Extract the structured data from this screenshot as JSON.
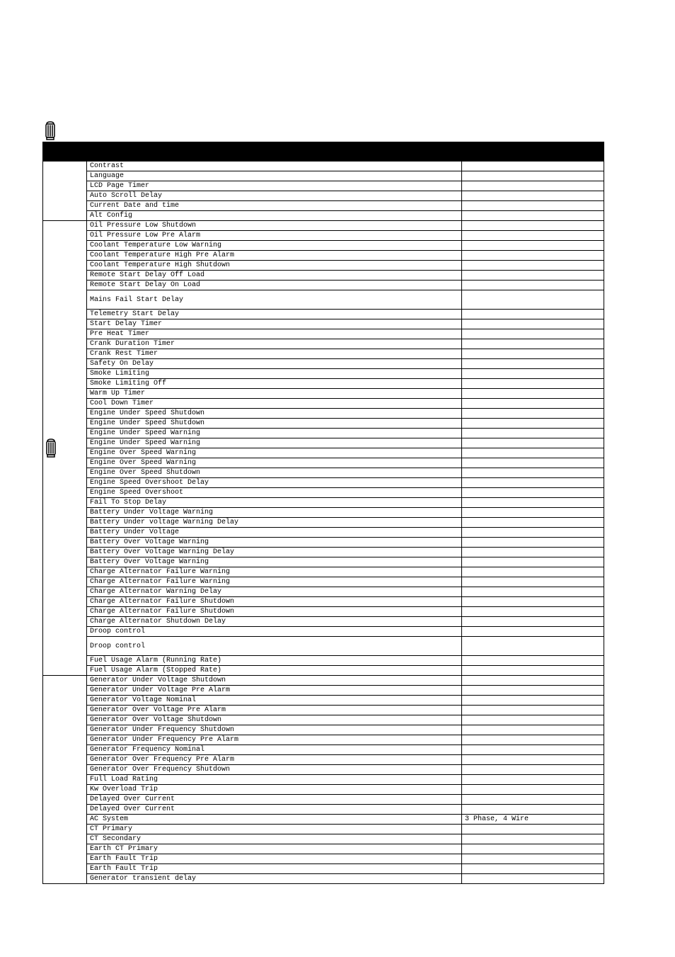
{
  "rows": [
    {
      "col1_type": "blank",
      "label": "Contrast",
      "value": "",
      "border_top_heavy": true
    },
    {
      "col1_type": "none",
      "label": "Language",
      "value": ""
    },
    {
      "col1_type": "none",
      "label": "LCD Page Timer",
      "value": ""
    },
    {
      "col1_type": "none",
      "label": "Auto Scroll Delay",
      "value": ""
    },
    {
      "col1_type": "none",
      "label": "Current Date and time",
      "value": ""
    },
    {
      "col1_type": "none",
      "label": "Alt Config",
      "value": ""
    },
    {
      "col1_type": "blank",
      "label": "Oil Pressure Low Shutdown",
      "value": "",
      "icon_rowspan": 43,
      "icon_name": "lantern-icon"
    },
    {
      "col1_type": "none",
      "label": "Oil Pressure Low Pre Alarm",
      "value": ""
    },
    {
      "col1_type": "none",
      "label": "Coolant Temperature Low Warning",
      "value": ""
    },
    {
      "col1_type": "none",
      "label": "Coolant Temperature High Pre Alarm",
      "value": ""
    },
    {
      "col1_type": "none",
      "label": "Coolant Temperature High Shutdown",
      "value": ""
    },
    {
      "col1_type": "none",
      "label": "Remote Start Delay Off Load",
      "value": ""
    },
    {
      "col1_type": "none",
      "label": "Remote Start Delay On Load",
      "value": ""
    },
    {
      "col1_type": "none",
      "label": "Mains Fail Start Delay",
      "value": "",
      "tall": true
    },
    {
      "col1_type": "none",
      "label": "Telemetry Start Delay",
      "value": ""
    },
    {
      "col1_type": "none",
      "label": "Start Delay Timer",
      "value": ""
    },
    {
      "col1_type": "none",
      "label": "Pre Heat Timer",
      "value": ""
    },
    {
      "col1_type": "none",
      "label": "Crank Duration Timer",
      "value": ""
    },
    {
      "col1_type": "none",
      "label": "Crank Rest Timer",
      "value": ""
    },
    {
      "col1_type": "none",
      "label": "Safety On Delay",
      "value": ""
    },
    {
      "col1_type": "none",
      "label": "Smoke Limiting",
      "value": ""
    },
    {
      "col1_type": "none",
      "label": "Smoke Limiting Off",
      "value": ""
    },
    {
      "col1_type": "none",
      "label": "Warm Up Timer",
      "value": ""
    },
    {
      "col1_type": "none",
      "label": "Cool Down Timer",
      "value": ""
    },
    {
      "col1_type": "none",
      "label": "Engine Under Speed Shutdown",
      "value": ""
    },
    {
      "col1_type": "none",
      "label": "Engine Under Speed Shutdown",
      "value": ""
    },
    {
      "col1_type": "none",
      "label": "Engine Under Speed Warning",
      "value": ""
    },
    {
      "col1_type": "none",
      "label": "Engine Under Speed Warning",
      "value": ""
    },
    {
      "col1_type": "none",
      "label": "Engine Over Speed Warning",
      "value": ""
    },
    {
      "col1_type": "none",
      "label": "Engine Over Speed Warning",
      "value": ""
    },
    {
      "col1_type": "none",
      "label": "Engine Over Speed Shutdown",
      "value": ""
    },
    {
      "col1_type": "none",
      "label": "Engine Speed Overshoot Delay",
      "value": ""
    },
    {
      "col1_type": "none",
      "label": "Engine Speed Overshoot",
      "value": ""
    },
    {
      "col1_type": "none",
      "label": "Fail To Stop Delay",
      "value": ""
    },
    {
      "col1_type": "none",
      "label": "Battery Under Voltage Warning",
      "value": ""
    },
    {
      "col1_type": "none",
      "label": "Battery Under voltage Warning Delay",
      "value": ""
    },
    {
      "col1_type": "none",
      "label": "Battery Under Voltage",
      "value": ""
    },
    {
      "col1_type": "none",
      "label": "Battery Over Voltage Warning",
      "value": ""
    },
    {
      "col1_type": "none",
      "label": "Battery Over Voltage Warning Delay",
      "value": ""
    },
    {
      "col1_type": "none",
      "label": "Battery Over Voltage Warning",
      "value": ""
    },
    {
      "col1_type": "none",
      "label": "Charge Alternator Failure Warning",
      "value": ""
    },
    {
      "col1_type": "none",
      "label": "Charge Alternator Failure Warning",
      "value": ""
    },
    {
      "col1_type": "none",
      "label": "Charge Alternator Warning Delay",
      "value": ""
    },
    {
      "col1_type": "none",
      "label": "Charge Alternator Failure Shutdown",
      "value": ""
    },
    {
      "col1_type": "none",
      "label": "Charge Alternator Failure Shutdown",
      "value": ""
    },
    {
      "col1_type": "none",
      "label": "Charge Alternator Shutdown Delay",
      "value": ""
    },
    {
      "col1_type": "none",
      "label": "Droop control",
      "value": ""
    },
    {
      "col1_type": "none",
      "label": "Droop control",
      "value": "",
      "tall": true
    },
    {
      "col1_type": "none",
      "label": "Fuel Usage Alarm (Running Rate)",
      "value": ""
    },
    {
      "col1_type": "none",
      "label": "Fuel Usage Alarm (Stopped Rate)",
      "value": ""
    },
    {
      "col1_type": "blank",
      "label": "Generator Under Voltage Shutdown",
      "value": ""
    },
    {
      "col1_type": "none",
      "label": "Generator Under Voltage Pre Alarm",
      "value": ""
    },
    {
      "col1_type": "none",
      "label": "Generator Voltage Nominal",
      "value": ""
    },
    {
      "col1_type": "none",
      "label": "Generator Over Voltage Pre Alarm",
      "value": ""
    },
    {
      "col1_type": "none",
      "label": "Generator Over Voltage Shutdown",
      "value": ""
    },
    {
      "col1_type": "none",
      "label": "Generator Under Frequency Shutdown",
      "value": ""
    },
    {
      "col1_type": "none",
      "label": "Generator Under Frequency Pre Alarm",
      "value": ""
    },
    {
      "col1_type": "none",
      "label": "Generator Frequency Nominal",
      "value": ""
    },
    {
      "col1_type": "none",
      "label": "Generator Over Frequency Pre Alarm",
      "value": ""
    },
    {
      "col1_type": "none",
      "label": "Generator Over Frequency Shutdown",
      "value": ""
    },
    {
      "col1_type": "none",
      "label": "Full Load Rating",
      "value": ""
    },
    {
      "col1_type": "none",
      "label": "Kw Overload Trip",
      "value": ""
    },
    {
      "col1_type": "none",
      "label": "Delayed Over Current",
      "value": ""
    },
    {
      "col1_type": "none",
      "label": "Delayed Over Current",
      "value": ""
    },
    {
      "col1_type": "none",
      "label": "AC System",
      "value": "3 Phase, 4 Wire"
    },
    {
      "col1_type": "none",
      "label": "CT Primary",
      "value": ""
    },
    {
      "col1_type": "none",
      "label": "CT Secondary",
      "value": ""
    },
    {
      "col1_type": "none",
      "label": "Earth CT Primary",
      "value": ""
    },
    {
      "col1_type": "none",
      "label": "Earth Fault Trip",
      "value": ""
    },
    {
      "col1_type": "none",
      "label": "Earth Fault Trip",
      "value": ""
    },
    {
      "col1_type": "none",
      "label": "Generator transient delay",
      "value": ""
    }
  ]
}
